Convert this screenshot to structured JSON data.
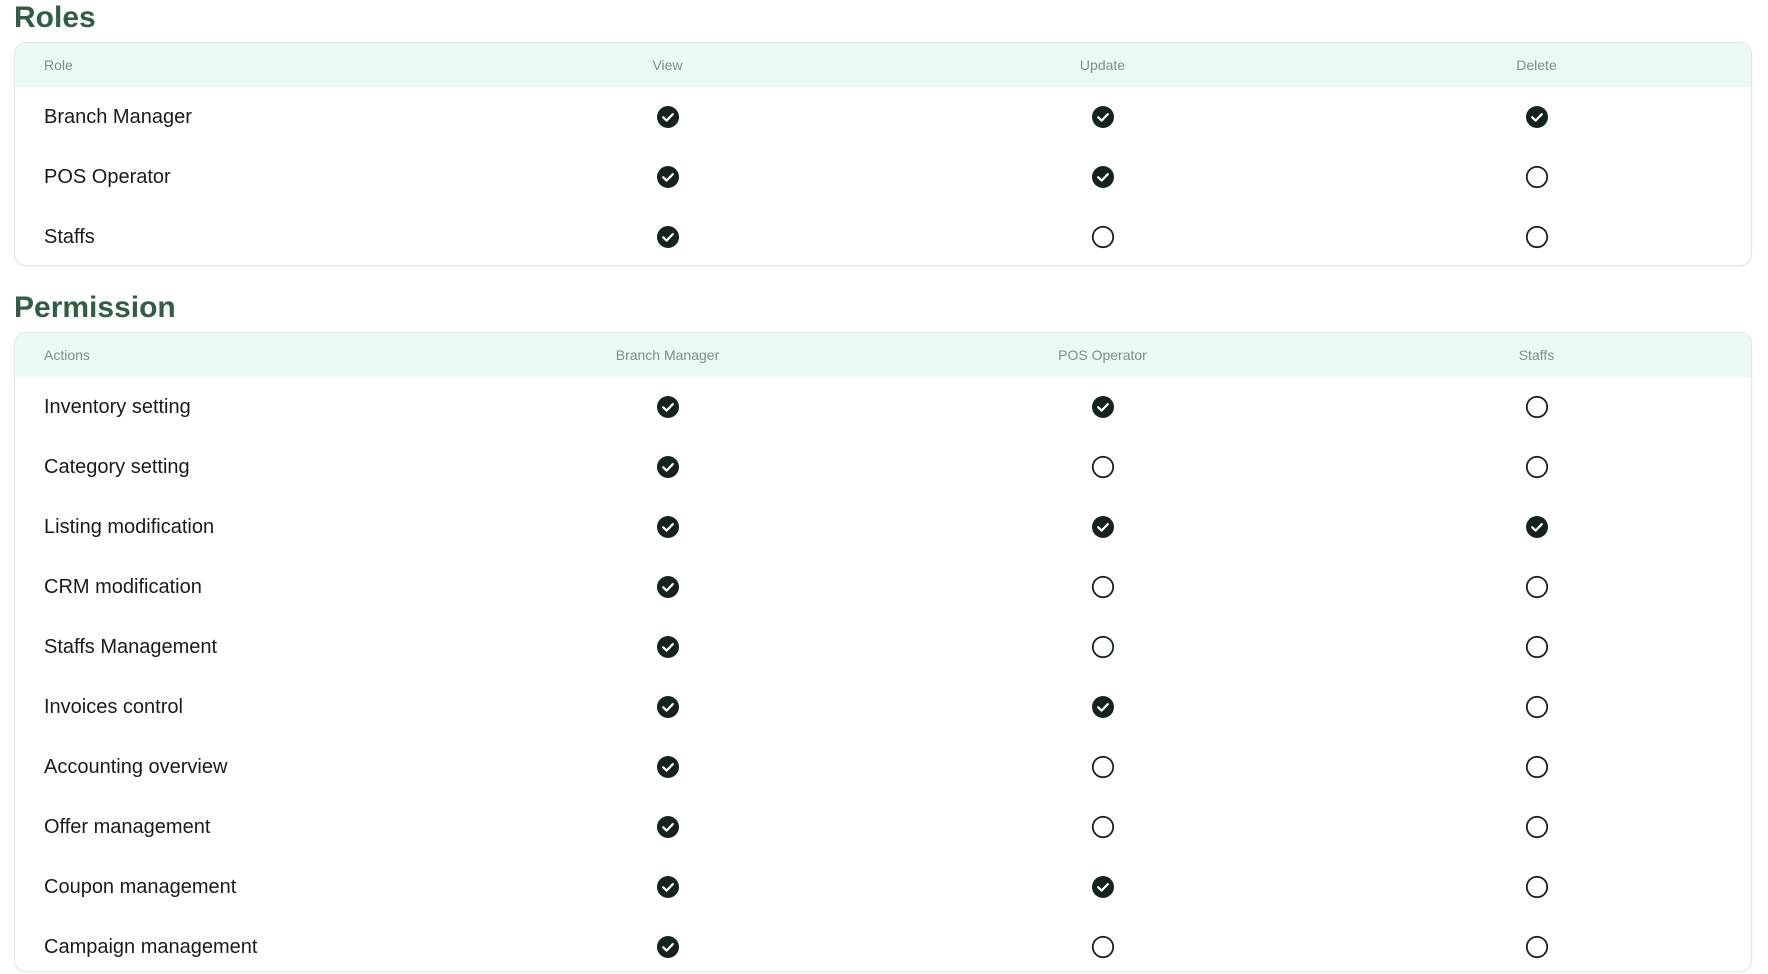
{
  "roles": {
    "title": "Roles",
    "headers": [
      "Role",
      "View",
      "Update",
      "Delete"
    ],
    "rows": [
      {
        "label": "Branch Manager",
        "values": [
          true,
          true,
          true
        ]
      },
      {
        "label": "POS Operator",
        "values": [
          true,
          true,
          false
        ]
      },
      {
        "label": "Staffs",
        "values": [
          true,
          false,
          false
        ]
      }
    ]
  },
  "permission": {
    "title": "Permission",
    "headers": [
      "Actions",
      "Branch Manager",
      "POS Operator",
      "Staffs"
    ],
    "rows": [
      {
        "label": "Inventory setting",
        "values": [
          true,
          true,
          false
        ]
      },
      {
        "label": "Category setting",
        "values": [
          true,
          false,
          false
        ]
      },
      {
        "label": "Listing modification",
        "values": [
          true,
          true,
          true
        ]
      },
      {
        "label": "CRM modification",
        "values": [
          true,
          false,
          false
        ]
      },
      {
        "label": "Staffs Management",
        "values": [
          true,
          false,
          false
        ]
      },
      {
        "label": "Invoices control",
        "values": [
          true,
          true,
          false
        ]
      },
      {
        "label": "Accounting overview",
        "values": [
          true,
          false,
          false
        ]
      },
      {
        "label": "Offer management",
        "values": [
          true,
          false,
          false
        ]
      },
      {
        "label": "Coupon management",
        "values": [
          true,
          true,
          false
        ]
      },
      {
        "label": "Campaign management",
        "values": [
          true,
          false,
          false
        ]
      }
    ]
  },
  "colors": {
    "title": "#2f5e43",
    "header_bg": "#ebfbf3",
    "header_text": "#7d8f85",
    "check_fill": "#15231d"
  },
  "icons": {
    "checked": "checked-circle-icon",
    "unchecked": "empty-circle-icon"
  }
}
